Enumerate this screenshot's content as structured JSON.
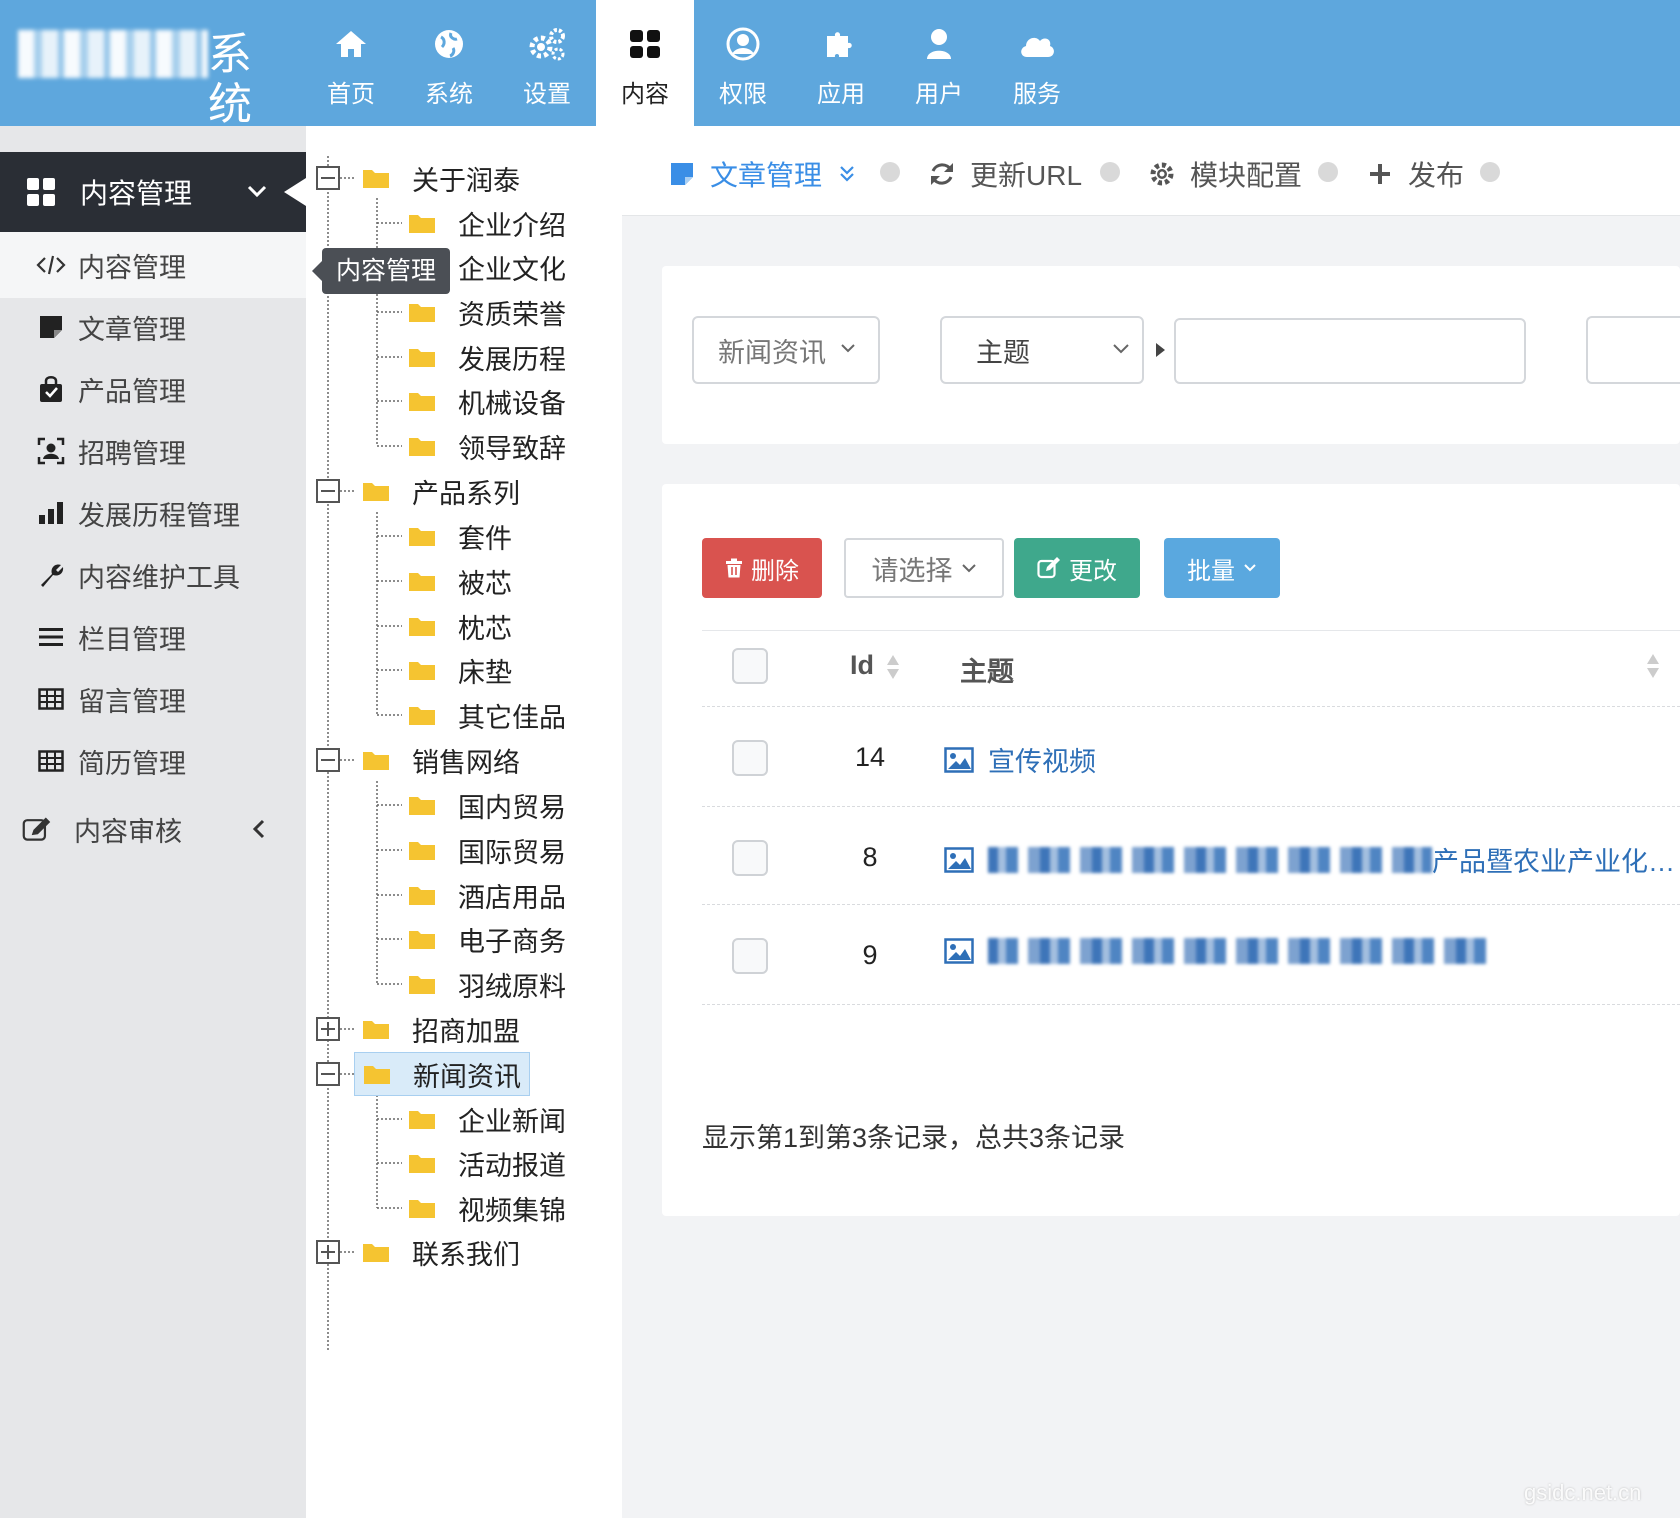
{
  "app": {
    "title_suffix": "系统"
  },
  "top_nav": [
    {
      "label": "首页",
      "icon": "home-icon"
    },
    {
      "label": "系统",
      "icon": "globe-icon"
    },
    {
      "label": "设置",
      "icon": "gears-icon"
    },
    {
      "label": "内容",
      "icon": "grid-icon",
      "active": true
    },
    {
      "label": "权限",
      "icon": "user-circle-icon"
    },
    {
      "label": "应用",
      "icon": "puzzle-icon"
    },
    {
      "label": "用户",
      "icon": "user-icon"
    },
    {
      "label": "服务",
      "icon": "cloud-icon"
    }
  ],
  "sidebar": {
    "header": "内容管理",
    "items": [
      {
        "label": "内容管理",
        "icon": "code-icon"
      },
      {
        "label": "文章管理",
        "icon": "note-icon"
      },
      {
        "label": "产品管理",
        "icon": "shopping-bag-icon"
      },
      {
        "label": "招聘管理",
        "icon": "id-card-icon"
      },
      {
        "label": "发展历程管理",
        "icon": "bar-chart-icon"
      },
      {
        "label": "内容维护工具",
        "icon": "wrench-icon"
      },
      {
        "label": "栏目管理",
        "icon": "list-icon"
      },
      {
        "label": "留言管理",
        "icon": "table-icon"
      },
      {
        "label": "简历管理",
        "icon": "table-icon"
      },
      {
        "label": "内容审核",
        "icon": "edit-icon"
      }
    ],
    "tooltip": "内容管理"
  },
  "tree": [
    {
      "label": "关于润泰",
      "children": [
        "企业介绍",
        "企业文化",
        "资质荣誉",
        "发展历程",
        "机械设备",
        "领导致辞"
      ]
    },
    {
      "label": "产品系列",
      "children": [
        "套件",
        "被芯",
        "枕芯",
        "床垫",
        "其它佳品"
      ]
    },
    {
      "label": "销售网络",
      "children": [
        "国内贸易",
        "国际贸易",
        "酒店用品",
        "电子商务",
        "羽绒原料"
      ]
    },
    {
      "label": "招商加盟",
      "children": []
    },
    {
      "label": "新闻资讯",
      "children": [
        "企业新闻",
        "活动报道",
        "视频集锦"
      ],
      "selected": true
    },
    {
      "label": "联系我们",
      "children": []
    }
  ],
  "tabs": {
    "article": "文章管理",
    "update_url": "更新URL",
    "module_config": "模块配置",
    "publish": "发布"
  },
  "filter": {
    "category": "新闻资讯",
    "field": "主题",
    "keyword_value": ""
  },
  "toolbar": {
    "delete": "删除",
    "pick": "请选择",
    "edit": "更改",
    "batch": "批量"
  },
  "table": {
    "headers": {
      "id": "Id",
      "title": "主题"
    },
    "rows": [
      {
        "id": "14",
        "title": "宣传视频",
        "blurred": false
      },
      {
        "id": "8",
        "title": "产品暨农业产业化…",
        "blurred": true
      },
      {
        "id": "9",
        "title": "",
        "blurred": true
      }
    ],
    "footer": "显示第1到第3条记录，总共3条记录"
  },
  "colors": {
    "topbar": "#5ea7dd",
    "delete": "#d9534f",
    "edit": "#3fa88c",
    "batch": "#5aa8df",
    "folder": "#f5c431",
    "link": "#2e6fb7"
  }
}
